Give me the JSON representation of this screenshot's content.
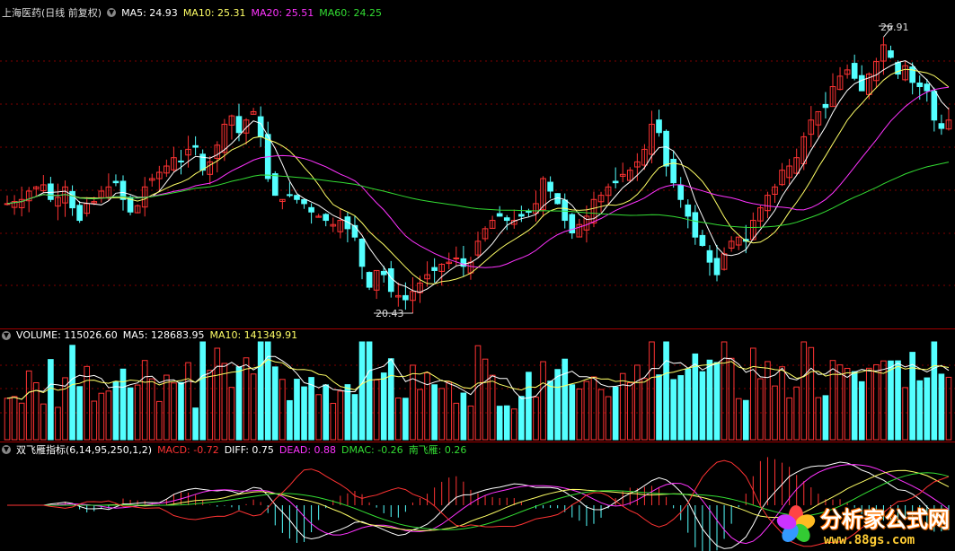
{
  "main_panel": {
    "title": "上海医药(日线 前复权)",
    "indicators": [
      {
        "label": "MA5: 24.93",
        "color": "#ffffff"
      },
      {
        "label": "MA10: 25.31",
        "color": "#ffff66"
      },
      {
        "label": "MA20: 25.51",
        "color": "#ff33ff"
      },
      {
        "label": "MA60: 24.25",
        "color": "#33dd33"
      }
    ],
    "high_label": "26.91",
    "low_label": "20.43"
  },
  "volume_panel": {
    "indicators": [
      {
        "label": "VOLUME: 115026.60",
        "color": "#ffffff"
      },
      {
        "label": "MA5: 128683.95",
        "color": "#ffffff"
      },
      {
        "label": "MA10: 141349.91",
        "color": "#ffff66"
      }
    ]
  },
  "macd_panel": {
    "indicators": [
      {
        "label": "双飞雁指标(6,14,95,250,1,2)",
        "color": "#ffffff"
      },
      {
        "label": "MACD: -0.72",
        "color": "#ff3333"
      },
      {
        "label": "DIFF: 0.75",
        "color": "#ffffff"
      },
      {
        "label": "DEAD: 0.88",
        "color": "#ff33ff"
      },
      {
        "label": "DMAC: -0.26",
        "color": "#33dd33"
      },
      {
        "label": "南飞雁: 0.26",
        "color": "#33dd33"
      }
    ]
  },
  "watermark": {
    "line1": "分析家公式网",
    "line2": "www.88gs.com"
  },
  "colors": {
    "up": "#ff3333",
    "down": "#54ffff",
    "separator": "#a00000",
    "grid": "#800000"
  },
  "chart_data": {
    "type": "candlestick",
    "price_range": [
      20.0,
      27.3
    ],
    "closes": [
      22.9,
      22.95,
      23.0,
      23.2,
      23.3,
      23.35,
      23.0,
      23.05,
      23.3,
      22.8,
      22.5,
      22.9,
      22.95,
      23.2,
      23.3,
      23.4,
      23.0,
      22.7,
      22.85,
      23.3,
      23.5,
      23.65,
      23.8,
      24.0,
      23.9,
      24.2,
      24.25,
      23.7,
      23.9,
      24.3,
      24.8,
      25.0,
      24.6,
      24.9,
      25.1,
      24.5,
      23.5,
      23.1,
      23.0,
      23.1,
      23.0,
      22.9,
      22.7,
      22.6,
      22.5,
      22.4,
      22.5,
      22.3,
      22.1,
      21.4,
      20.9,
      21.3,
      21.2,
      20.8,
      20.7,
      20.6,
      20.8,
      21.0,
      21.2,
      21.3,
      21.45,
      21.5,
      21.6,
      21.4,
      21.5,
      22.0,
      22.3,
      22.5,
      22.6,
      22.5,
      22.5,
      22.6,
      22.7,
      22.9,
      23.5,
      23.2,
      22.9,
      22.5,
      22.2,
      22.4,
      22.6,
      23.0,
      23.1,
      23.3,
      23.4,
      23.6,
      23.7,
      23.9,
      24.2,
      24.8,
      24.6,
      23.8,
      23.4,
      23.0,
      22.6,
      22.1,
      21.9,
      21.5,
      21.2,
      21.7,
      22.0,
      22.1,
      22.0,
      22.5,
      22.8,
      23.1,
      23.3,
      23.7,
      23.8,
      24.0,
      24.5,
      24.9,
      25.1,
      25.2,
      25.7,
      25.95,
      26.1,
      25.9,
      25.6,
      26.0,
      26.3,
      26.7,
      26.4,
      26.0,
      26.2,
      25.8,
      25.7,
      25.6,
      24.9,
      24.7,
      24.9
    ]
  }
}
